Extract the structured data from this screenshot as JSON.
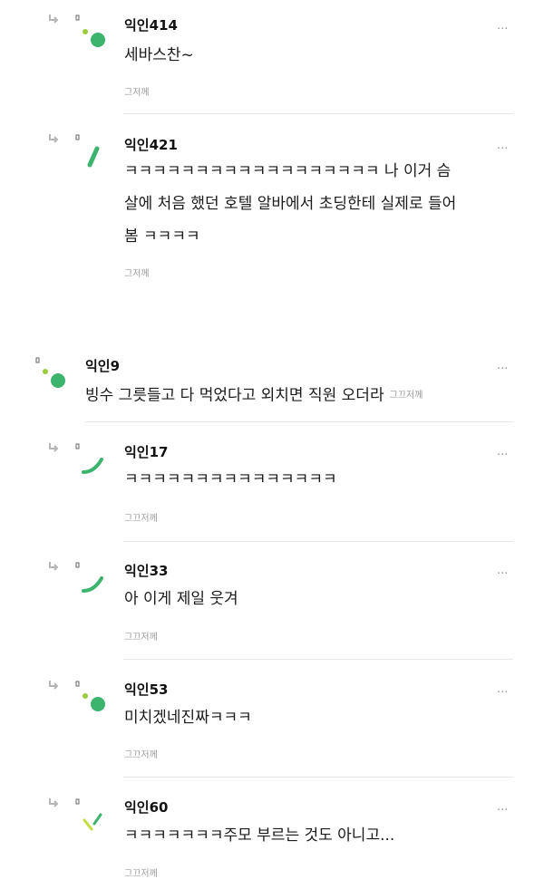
{
  "comments": [
    {
      "nick": "익인414",
      "lines": [
        "세바스찬~"
      ],
      "time": "그저께",
      "avatar": "dots"
    },
    {
      "nick": "익인421",
      "lines": [
        "ㅋㅋㅋㅋㅋㅋㅋㅋㅋㅋㅋㅋㅋㅋㅋㅋㅋㅋ 나 이거 슴",
        "살에 처음 했던 호텔 알바에서 초딩한테 실제로 들어",
        "봄 ㅋㅋㅋㅋ"
      ],
      "time": "그저께",
      "avatar": "slash"
    },
    {
      "nick": "익인9",
      "lines": [
        "빙수 그릇들고 다 먹었다고 외치면 직원 오더라"
      ],
      "time": "그끄저께",
      "avatar": "dots"
    },
    {
      "nick": "익인17",
      "lines": [
        "ㅋㅋㅋㅋㅋㅋㅋㅋㅋㅋㅋㅋㅋㅋㅋ"
      ],
      "time": "그끄저께",
      "avatar": "smile"
    },
    {
      "nick": "익인33",
      "lines": [
        "아 이게 제일 웃겨"
      ],
      "time": "그끄저께",
      "avatar": "smile"
    },
    {
      "nick": "익인53",
      "lines": [
        "미치겠네진짜ㅋㅋㅋ"
      ],
      "time": "그끄저께",
      "avatar": "dots"
    },
    {
      "nick": "익인60",
      "lines": [
        "ㅋㅋㅋㅋㅋㅋㅋ주모 부르는 것도 아니고..."
      ],
      "time": "그끄저께",
      "avatar": "sticks"
    }
  ],
  "more_label": "···",
  "colors": {
    "green": "#3cb46e",
    "light_green": "#9ccc3c",
    "lime": "#c6dc3c"
  }
}
